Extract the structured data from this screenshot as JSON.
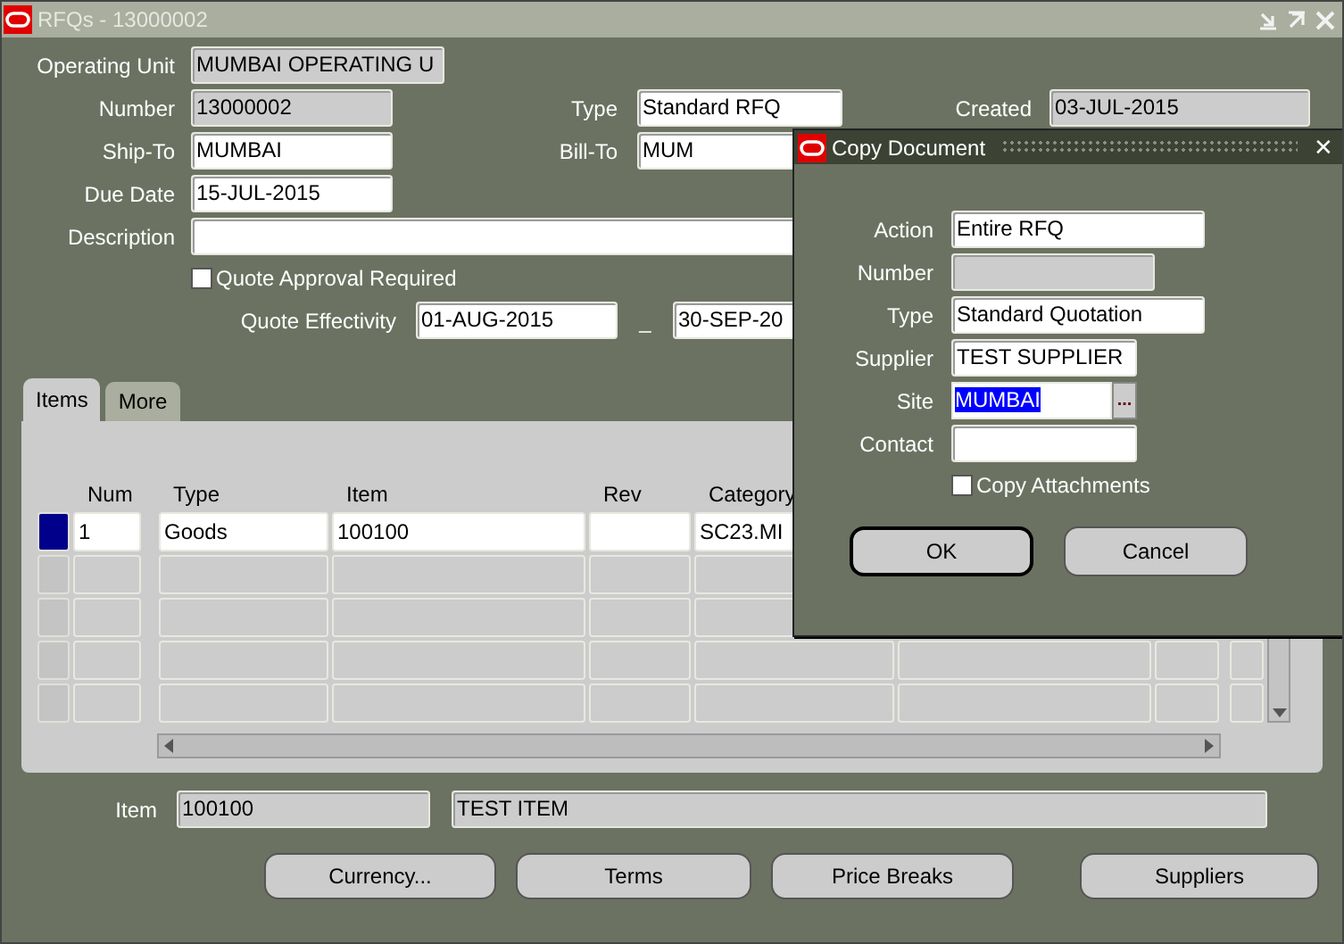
{
  "window": {
    "title": "RFQs - 13000002"
  },
  "header": {
    "operating_unit": {
      "label": "Operating Unit",
      "value": "MUMBAI OPERATING U",
      "readonly": true
    },
    "number": {
      "label": "Number",
      "value": "13000002",
      "readonly": true
    },
    "type": {
      "label": "Type",
      "value": "Standard RFQ",
      "readonly": false
    },
    "created": {
      "label": "Created",
      "value": "03-JUL-2015",
      "readonly": true
    },
    "ship_to": {
      "label": "Ship-To",
      "value": "MUMBAI",
      "readonly": false
    },
    "bill_to": {
      "label": "Bill-To",
      "value": "MUM",
      "readonly": false
    },
    "due_date": {
      "label": "Due Date",
      "value": "15-JUL-2015",
      "readonly": false
    },
    "description": {
      "label": "Description",
      "readonly": false
    },
    "quote_approval": {
      "label": "Quote Approval Required",
      "checked": false
    },
    "quote_effectivity": {
      "label": "Quote Effectivity",
      "from": "01-AUG-2015",
      "separator": "_",
      "to": "30-SEP-20"
    }
  },
  "tabs": [
    {
      "label": "Items",
      "selected": true
    },
    {
      "label": "More",
      "selected": false
    }
  ],
  "table": {
    "columns": [
      "Num",
      "Type",
      "Item",
      "Rev",
      "Category"
    ],
    "rows": [
      {
        "selected": true,
        "num": "1",
        "type": "Goods",
        "item": "100100",
        "category": "SC23.MI"
      },
      {
        "selected": false
      },
      {
        "selected": false
      },
      {
        "selected": false
      },
      {
        "selected": false
      }
    ]
  },
  "item_footer": {
    "label": "Item",
    "code": "100100",
    "description": "TEST ITEM"
  },
  "buttons": [
    "Currency...",
    "Terms",
    "Price Breaks",
    "Suppliers"
  ],
  "dialog": {
    "title": "Copy Document",
    "close": "✕",
    "fields": [
      {
        "label": "Action",
        "value": "Entire RFQ",
        "readonly": false,
        "kind": "text"
      },
      {
        "label": "Number",
        "readonly": true,
        "kind": "text"
      },
      {
        "label": "Type",
        "value": "Standard Quotation",
        "readonly": false,
        "kind": "text"
      },
      {
        "label": "Supplier",
        "value": "TEST SUPPLIER",
        "readonly": false,
        "kind": "text"
      },
      {
        "label": "Site",
        "value": "MUMBAI",
        "readonly": false,
        "kind": "lov",
        "highlighted": true,
        "lov_label": "..."
      },
      {
        "label": "Contact",
        "readonly": false,
        "kind": "text"
      }
    ],
    "copy_attachments": {
      "label": "Copy Attachments",
      "checked": false
    },
    "buttons": [
      {
        "label": "OK",
        "default": true
      },
      {
        "label": "Cancel",
        "default": false
      }
    ]
  }
}
